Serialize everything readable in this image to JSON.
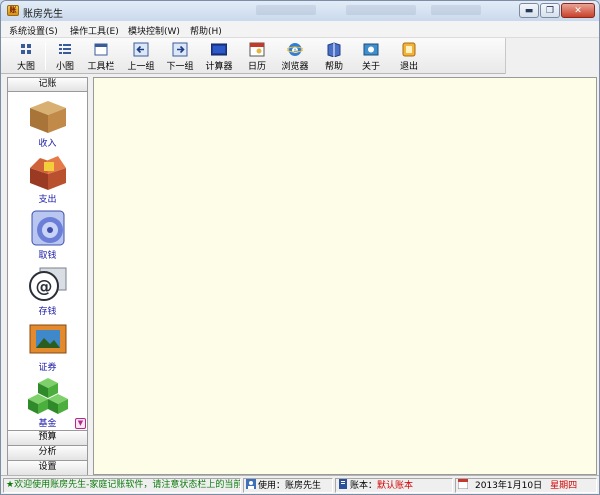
{
  "window": {
    "title": "账房先生",
    "app_icon_text": "账",
    "controls": {
      "minimize": "▬",
      "maximize": "❐",
      "close": "✕"
    }
  },
  "menu": [
    "系统设置(S)",
    "操作工具(E)",
    "模块控制(W)",
    "帮助(H)"
  ],
  "toolbar": [
    {
      "label": "大图",
      "icon": "large-icons-icon"
    },
    {
      "label": "小图",
      "icon": "small-icons-icon"
    },
    {
      "label": "工具栏",
      "icon": "toolbar-icon"
    },
    {
      "label": "上一组",
      "icon": "prev-group-icon"
    },
    {
      "label": "下一组",
      "icon": "next-group-icon"
    },
    {
      "label": "计算器",
      "icon": "calculator-icon"
    },
    {
      "label": "日历",
      "icon": "calendar-icon"
    },
    {
      "label": "浏览器",
      "icon": "browser-icon"
    },
    {
      "label": "帮助",
      "icon": "help-book-icon"
    },
    {
      "label": "关于",
      "icon": "about-icon"
    },
    {
      "label": "退出",
      "icon": "exit-icon"
    }
  ],
  "sidebar": {
    "header": "记账",
    "items": [
      {
        "label": "收入",
        "icon": "closed-box-icon"
      },
      {
        "label": "支出",
        "icon": "open-box-icon"
      },
      {
        "label": "取钱",
        "icon": "cd-icon"
      },
      {
        "label": "存钱",
        "icon": "at-sign-icon"
      },
      {
        "label": "证券",
        "icon": "picture-frame-icon"
      },
      {
        "label": "基金",
        "icon": "green-cubes-icon"
      }
    ],
    "scroll_glyph": "▼",
    "groups": [
      "预算",
      "分析",
      "设置"
    ]
  },
  "status": {
    "marquee": "★欢迎使用账房先生-家庭记账软件，请注意状态栏上的当前账本",
    "user_label": "使用：账房先生",
    "book_label": "账本：",
    "book_value": "默认账本",
    "date": "2013年1月10日",
    "weekday": "星期四"
  },
  "colors": {
    "content_bg": "#fefee8",
    "sidebar_label": "#1a1aa6",
    "status_green": "#0a7a0a",
    "status_red": "#d40000"
  }
}
